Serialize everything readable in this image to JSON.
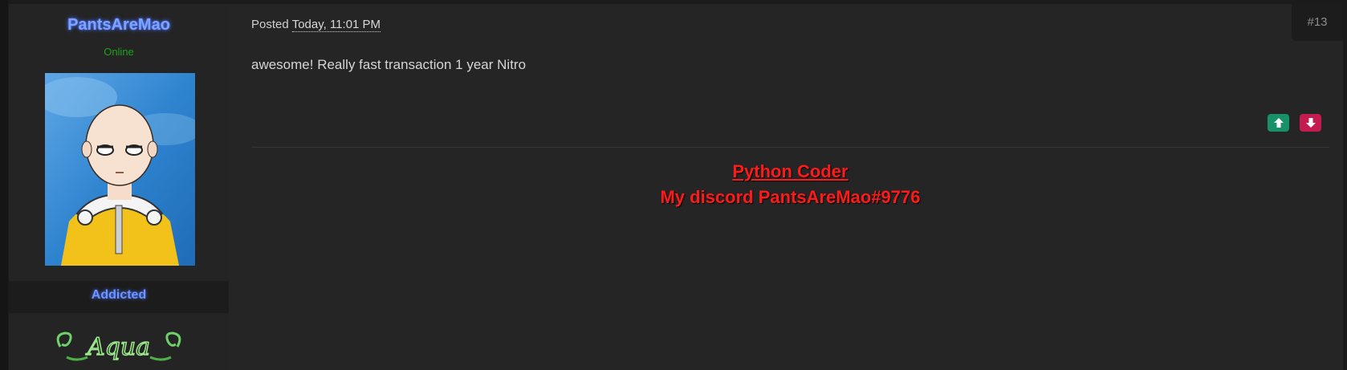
{
  "author": {
    "username": "PantsAreMao",
    "status": "Online",
    "rank": "Addicted",
    "rank_badge_text": "Aqua",
    "avatar_description": "bald anime character avatar",
    "colors": {
      "username": "#7ea3ff",
      "online": "#1fa01f",
      "rank": "#6e95ff"
    }
  },
  "post": {
    "posted_label": "Posted",
    "posted_date": "Today, 11:01 PM",
    "post_number": "#13",
    "message": "awesome! Really fast transaction 1 year Nitro",
    "vote_up_icon": "arrow-up-icon",
    "vote_down_icon": "arrow-down-icon",
    "colors": {
      "vote_up": "#189068",
      "vote_down": "#c41c4f"
    }
  },
  "signature": {
    "line1": "Python Coder",
    "line2": "My discord PantsAreMao#9776",
    "color": "#ff1a1a"
  }
}
